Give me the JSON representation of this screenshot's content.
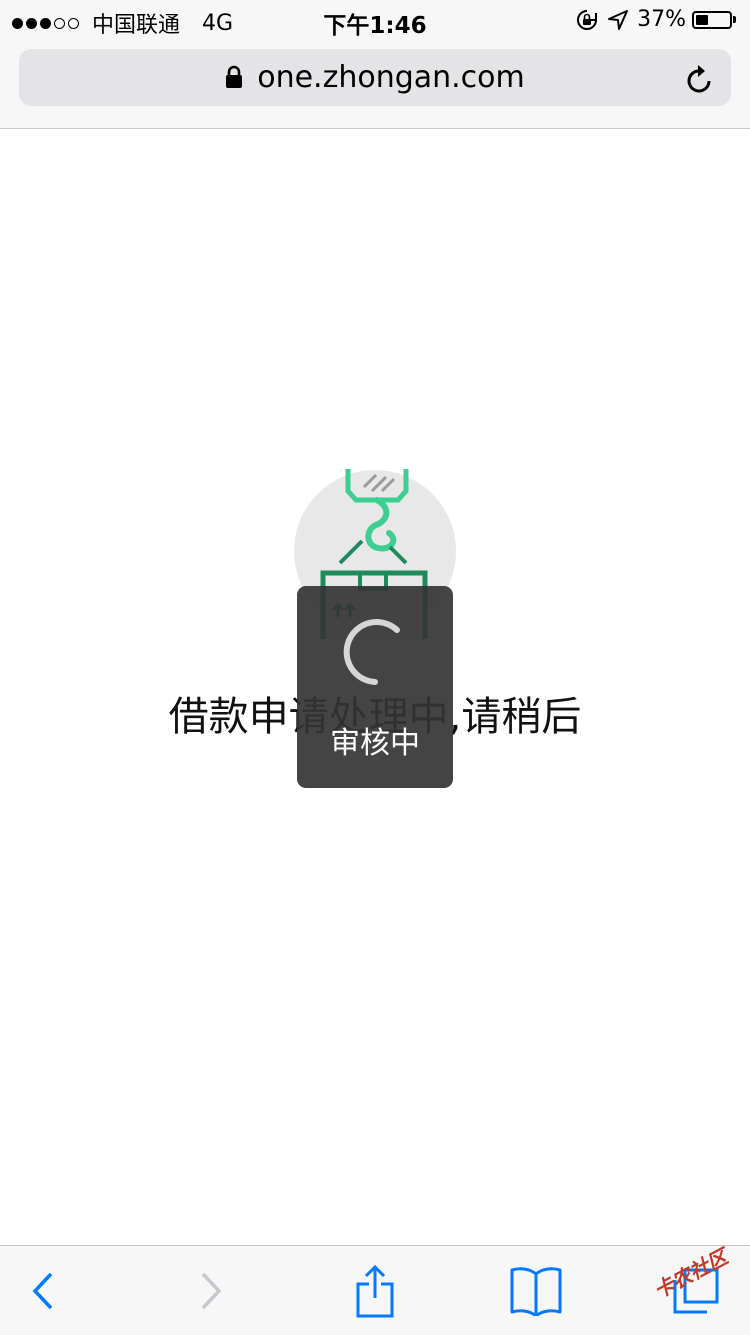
{
  "status_bar": {
    "carrier": "中国联通",
    "network": "4G",
    "time": "下午1:46",
    "battery_percent": "37%",
    "battery_level": 0.37,
    "signal_bars_filled": 3,
    "signal_bars_total": 5
  },
  "url_bar": {
    "url": "one.zhongan.com",
    "lock_icon": "lock-icon",
    "reload_icon": "reload-icon"
  },
  "content": {
    "message": "借款申请处理中,请稍后",
    "illustration_icon": "crane-hook-box-icon",
    "accent_color": "#3ccf91"
  },
  "loading_toast": {
    "spinner_icon": "spinner-icon",
    "label": "审核中"
  },
  "toolbar": {
    "back_icon": "chevron-left-icon",
    "forward_icon": "chevron-right-icon",
    "share_icon": "share-icon",
    "bookmarks_icon": "book-icon",
    "tabs_icon": "tabs-icon",
    "active_color": "#007aff",
    "disabled_color": "#c7c7cc"
  },
  "watermark": "卡农社区"
}
